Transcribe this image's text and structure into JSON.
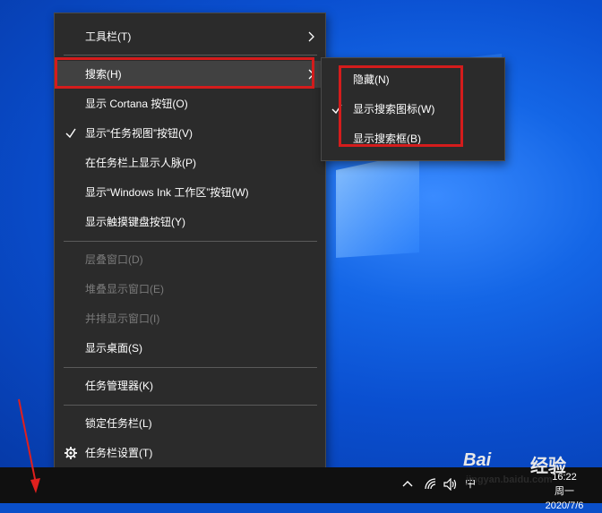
{
  "context_menu": {
    "items": [
      {
        "label": "工具栏(T)"
      },
      {
        "label": "搜索(H)"
      },
      {
        "label": "显示 Cortana 按钮(O)"
      },
      {
        "label": "显示“任务视图”按钮(V)"
      },
      {
        "label": "在任务栏上显示人脉(P)"
      },
      {
        "label": "显示“Windows Ink 工作区”按钮(W)"
      },
      {
        "label": "显示触摸键盘按钮(Y)"
      },
      {
        "label": "层叠窗口(D)"
      },
      {
        "label": "堆叠显示窗口(E)"
      },
      {
        "label": "并排显示窗口(I)"
      },
      {
        "label": "显示桌面(S)"
      },
      {
        "label": "任务管理器(K)"
      },
      {
        "label": "锁定任务栏(L)"
      },
      {
        "label": "任务栏设置(T)"
      }
    ]
  },
  "search_submenu": {
    "items": [
      {
        "label": "隐藏(N)"
      },
      {
        "label": "显示搜索图标(W)"
      },
      {
        "label": "显示搜索框(B)"
      }
    ]
  },
  "taskbar": {
    "ime": "中",
    "time": "16:22",
    "date": "周一2020/7/6"
  },
  "watermark": {
    "logo": "Bai",
    "cn": "经验",
    "site": "jingyan.baidu.com"
  },
  "colors": {
    "menu_bg": "#2b2b2b",
    "highlight_box": "#d41c1c",
    "desktop_blue": "#0a4fc9"
  }
}
